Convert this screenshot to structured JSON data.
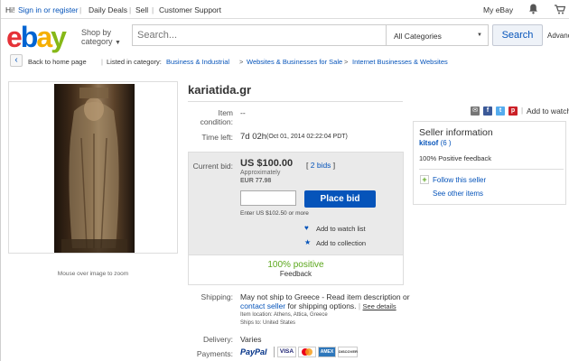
{
  "topbar": {
    "greeting": "Hi!",
    "signin": "Sign in or register",
    "daily_deals": "Daily Deals",
    "sell": "Sell",
    "customer_support": "Customer Support",
    "my_ebay": "My eBay"
  },
  "header": {
    "logo_letters": [
      "e",
      "b",
      "a",
      "y"
    ],
    "shop_by_line1": "Shop by",
    "shop_by_line2": "category",
    "search_placeholder": "Search...",
    "category_select": "All Categories",
    "search_button": "Search",
    "advanced": "Advanc"
  },
  "breadcrumb": {
    "back": "Back to home page",
    "listed_in": "Listed in category:",
    "items": [
      "Business & Industrial",
      "Websites & Businesses for Sale",
      "Internet Businesses & Websites"
    ]
  },
  "image_panel": {
    "caption": "Mouse over image to zoom"
  },
  "item": {
    "title": "kariatida.gr",
    "condition_label_1": "Item",
    "condition_label_2": "condition:",
    "condition_value": "--",
    "time_left_label": "Time left:",
    "time_left_value": "7d 02h",
    "time_left_detail": "(Oct 01, 2014   02:22:04 PDT)"
  },
  "bid": {
    "current_bid_label": "Current bid:",
    "price": "US $100.00",
    "bids_link": "2 bids",
    "approx_label": "Approximately",
    "approx_value": "EUR 77.98",
    "place_bid": "Place bid",
    "enter_hint": "Enter US $102.50 or more",
    "watch_list": "Add to watch list",
    "add_collection": "Add to collection",
    "positive_pct": "100% positive",
    "feedback": "Feedback"
  },
  "shipping": {
    "label": "Shipping:",
    "line1": "May not ship to Greece - Read item description or",
    "contact_link": "contact seller",
    "line2_rest": " for shipping options.",
    "see_details": "See details",
    "item_location": "Item location:  Athens, Attica, Greece",
    "ships_to": "Ships to:  United States"
  },
  "delivery": {
    "label": "Delivery:",
    "value": "Varies"
  },
  "payments": {
    "label": "Payments:",
    "methods": [
      "PayPal",
      "VISA",
      "MC",
      "AMEX",
      "DISCOVER"
    ]
  },
  "share": {
    "add_to_watch": "Add to watch"
  },
  "seller": {
    "heading": "Seller information",
    "name": "kitsof",
    "score": "(6 )",
    "positive": "100% Positive feedback",
    "follow": "Follow this seller",
    "see_other": "See other items"
  },
  "colors": {
    "link": "#0654ba",
    "bid_button": "#0654ba",
    "positive_green": "#5ba71b",
    "paypal_dark": "#003087",
    "paypal_light": "#009cde"
  }
}
